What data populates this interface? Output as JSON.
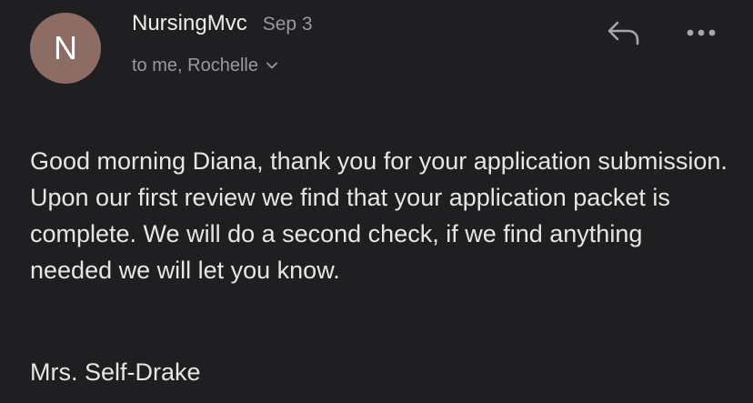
{
  "sender": {
    "avatar_initial": "N",
    "name": "NursingMvc",
    "date": "Sep 3",
    "recipients": "to me, Rochelle",
    "avatar_color": "#8d6c64"
  },
  "actions": {
    "reply_icon": "reply-icon",
    "more_icon": "more-horizontal-icon"
  },
  "message": {
    "body": "Good morning Diana, thank you for your application submission. Upon our first review we find that your application packet is complete. We will do a second check, if we find anything needed we will let you know.",
    "signature": "Mrs. Self-Drake"
  },
  "colors": {
    "background": "#1f1f21",
    "primary_text": "#e6e6e6",
    "secondary_text": "#9a9a9e"
  }
}
